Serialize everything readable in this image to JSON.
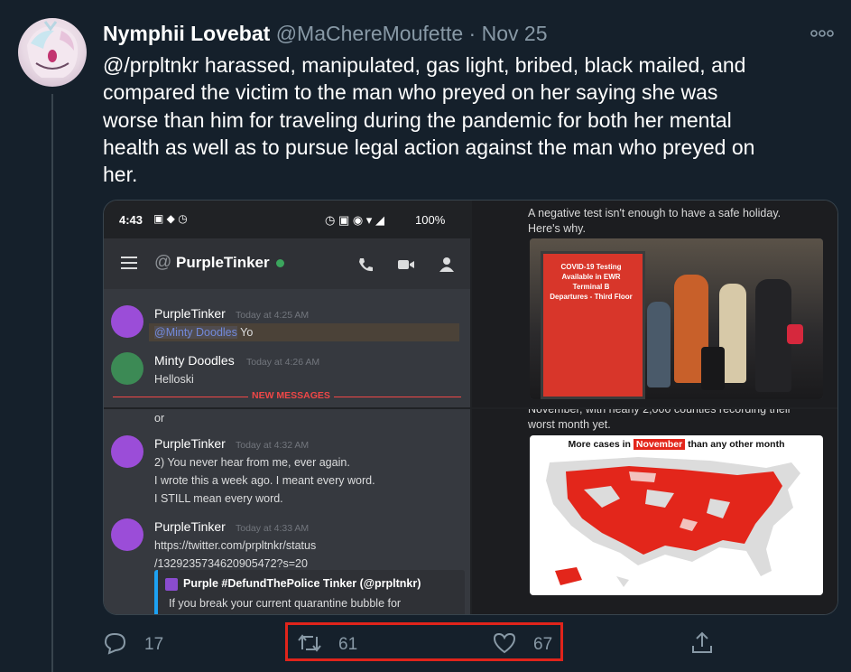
{
  "tweet": {
    "display_name": "Nymphii Lovebat",
    "handle": "@MaChereMoufette",
    "separator": "·",
    "date": "Nov 25",
    "text_lines": [
      "@/prpltnkr harassed, manipulated, gas light, bribed, black mailed, and",
      "compared the victim to the man who preyed on her saying she was",
      "worse than him for traveling during the pandemic for both her mental",
      "health as well as to pursue legal action against the man who preyed on",
      "her."
    ]
  },
  "media": {
    "discord": {
      "status_time": "4:43",
      "battery": "100%",
      "at_symbol": "@",
      "channel": "PurpleTinker",
      "new_messages_label": "NEW MESSAGES",
      "messages_top": [
        {
          "author": "PurpleTinker",
          "time": "Today at 4:25 AM",
          "mention": "@Minty Doodles",
          "rest": " Yo"
        },
        {
          "author": "Minty Doodles",
          "time": "Today at 4:26 AM",
          "line": "Helloski"
        }
      ],
      "messages_bottom": [
        {
          "line": "or"
        },
        {
          "author": "PurpleTinker",
          "time": "Today at 4:32 AM",
          "lines": [
            "2) You never hear from me, ever again.",
            "I wrote this a week ago. I meant every word.",
            "I STILL mean every word."
          ]
        },
        {
          "author": "PurpleTinker",
          "time": "Today at 4:33 AM",
          "links": [
            "https://twitter.com/prpltnkr/status",
            "/1329235734620905472?s=20"
          ]
        }
      ],
      "embed": {
        "author": "Purple #DefundThePolice Tinker (@prpltnkr)",
        "text": "If you break your current quarantine bubble for"
      }
    },
    "news_top": {
      "lines": [
        "A negative test isn't enough to have a safe holiday.",
        "Here's why."
      ],
      "sign_lines": [
        "COVID-19 Testing",
        "Available in EWR Terminal B",
        "Departures - Third Floor"
      ]
    },
    "news_bottom": {
      "lines": [
        "November, with nearly 2,000 counties recording their",
        "worst month yet."
      ],
      "map_title_pre": "More cases in ",
      "map_title_highlight": "November",
      "map_title_post": " than any other month"
    }
  },
  "actions": {
    "replies": "17",
    "retweets": "61",
    "likes": "67"
  },
  "colors": {
    "background": "#15202b",
    "secondary_text": "#8899a6",
    "highlight_box": "#e0241b",
    "map_red": "#e3261b"
  }
}
